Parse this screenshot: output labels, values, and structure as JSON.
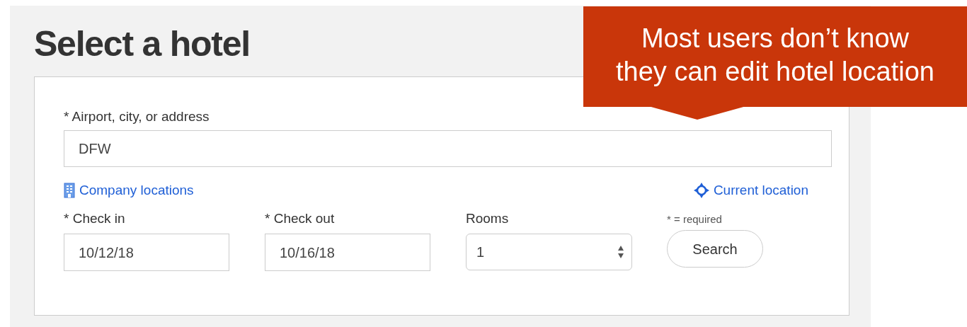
{
  "title": "Select a hotel",
  "location": {
    "label": "* Airport, city, or address",
    "value": "DFW"
  },
  "links": [
    {
      "kind": "building",
      "label": "Company locations"
    },
    {
      "kind": "crosshair",
      "label": "Current location"
    }
  ],
  "fields": [
    {
      "kind": "text",
      "label": "* Check in",
      "value": "10/12/18"
    },
    {
      "kind": "text",
      "label": "* Check out",
      "value": "10/16/18"
    },
    {
      "kind": "select",
      "label": "Rooms",
      "value": "1"
    }
  ],
  "required_note": "* = required",
  "search_button": "Search",
  "callout": {
    "lines": [
      "Most users don’t know",
      "they can edit hotel location"
    ]
  }
}
